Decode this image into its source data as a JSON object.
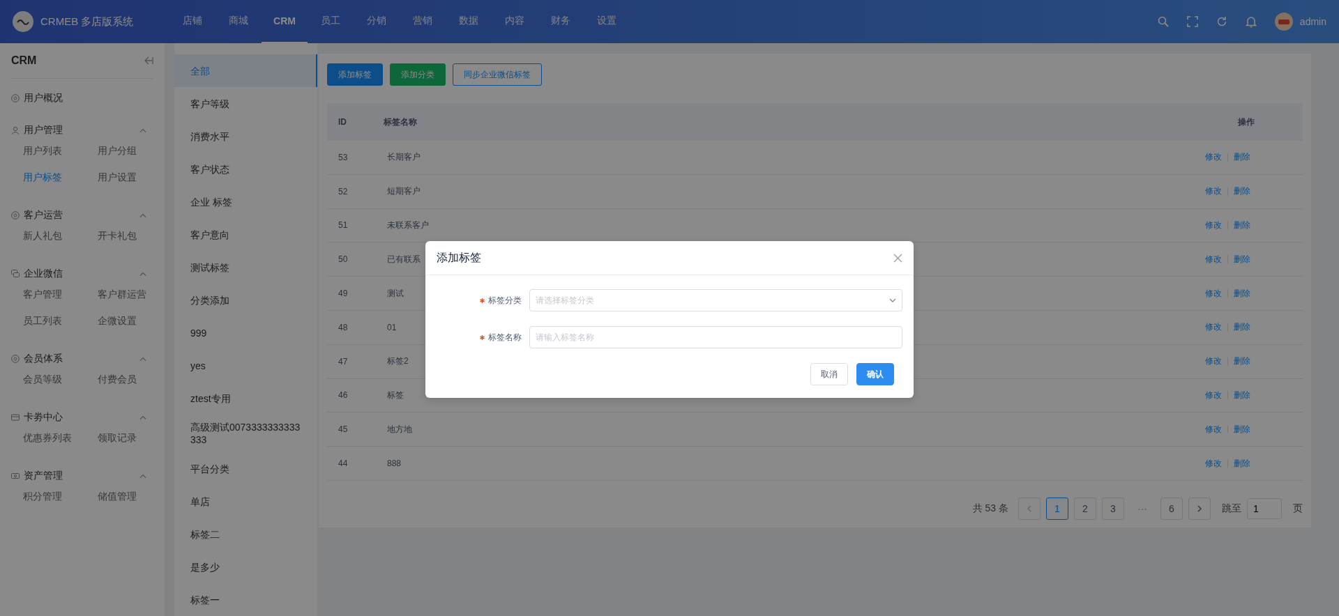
{
  "header": {
    "logo_text": "CRMEB 多店版系统",
    "nav": [
      {
        "label": "店铺",
        "selected": false
      },
      {
        "label": "商城",
        "selected": false
      },
      {
        "label": "CRM",
        "selected": true
      },
      {
        "label": "员工",
        "selected": false
      },
      {
        "label": "分销",
        "selected": false
      },
      {
        "label": "营销",
        "selected": false
      },
      {
        "label": "数据",
        "selected": false
      },
      {
        "label": "内容",
        "selected": false
      },
      {
        "label": "财务",
        "selected": false
      },
      {
        "label": "设置",
        "selected": false
      }
    ],
    "user": "admin"
  },
  "sidebar": {
    "title": "CRM",
    "groups": [
      {
        "label": "用户概况"
      },
      {
        "label": "用户管理",
        "expanded": true,
        "items": [
          {
            "label": "用户列表",
            "selected": false
          },
          {
            "label": "用户分组",
            "selected": false
          },
          {
            "label": "用户标签",
            "selected": true
          },
          {
            "label": "用户设置",
            "selected": false
          }
        ]
      },
      {
        "label": "客户运营",
        "expanded": true,
        "items": [
          {
            "label": "新人礼包",
            "selected": false
          },
          {
            "label": "开卡礼包",
            "selected": false
          }
        ]
      },
      {
        "label": "企业微信",
        "expanded": true,
        "items": [
          {
            "label": "客户管理",
            "selected": false
          },
          {
            "label": "客户群运营",
            "selected": false
          },
          {
            "label": "员工列表",
            "selected": false
          },
          {
            "label": "企微设置",
            "selected": false
          }
        ]
      },
      {
        "label": "会员体系",
        "expanded": true,
        "items": [
          {
            "label": "会员等级",
            "selected": false
          },
          {
            "label": "付费会员",
            "selected": false
          }
        ]
      },
      {
        "label": "卡劵中心",
        "expanded": true,
        "items": [
          {
            "label": "优惠券列表",
            "selected": false
          },
          {
            "label": "领取记录",
            "selected": false
          }
        ]
      },
      {
        "label": "资产管理",
        "expanded": true,
        "items": [
          {
            "label": "积分管理",
            "selected": false
          },
          {
            "label": "储值管理",
            "selected": false
          }
        ]
      }
    ]
  },
  "categories": [
    {
      "label": "全部",
      "selected": true
    },
    {
      "label": "客户等级",
      "selected": false
    },
    {
      "label": "消费水平",
      "selected": false
    },
    {
      "label": "客户状态",
      "selected": false
    },
    {
      "label": "企业 标签",
      "selected": false
    },
    {
      "label": "客户意向",
      "selected": false
    },
    {
      "label": "测试标签",
      "selected": false
    },
    {
      "label": "分类添加",
      "selected": false
    },
    {
      "label": "999",
      "selected": false
    },
    {
      "label": "yes",
      "selected": false
    },
    {
      "label": "ztest专用",
      "selected": false
    },
    {
      "label": "高级测试0073333333333333",
      "selected": false
    },
    {
      "label": "平台分类",
      "selected": false
    },
    {
      "label": "单店",
      "selected": false
    },
    {
      "label": "标签二",
      "selected": false
    },
    {
      "label": "是多少",
      "selected": false
    },
    {
      "label": "标签一",
      "selected": false
    }
  ],
  "toolbar": [
    {
      "label": "添加标签",
      "kind": "primary"
    },
    {
      "label": "添加分类",
      "kind": "success"
    },
    {
      "label": "同步企业微信标签",
      "kind": "outline"
    }
  ],
  "table": {
    "columns": [
      "ID",
      "标签名称",
      "操作"
    ],
    "rows": [
      {
        "id": "53",
        "name": "长期客户",
        "actions": [
          "修改",
          "删除"
        ]
      },
      {
        "id": "52",
        "name": "短期客户",
        "actions": [
          "修改",
          "删除"
        ]
      },
      {
        "id": "51",
        "name": "未联系客户",
        "actions": [
          "修改",
          "删除"
        ]
      },
      {
        "id": "50",
        "name": "已有联系",
        "actions": [
          "修改",
          "删除"
        ]
      },
      {
        "id": "49",
        "name": "测试",
        "actions": [
          "修改",
          "删除"
        ]
      },
      {
        "id": "48",
        "name": "01",
        "actions": [
          "修改",
          "删除"
        ]
      },
      {
        "id": "47",
        "name": "标签2",
        "actions": [
          "修改",
          "删除"
        ]
      },
      {
        "id": "46",
        "name": "标签",
        "actions": [
          "修改",
          "删除"
        ]
      },
      {
        "id": "45",
        "name": "地方地",
        "actions": [
          "修改",
          "删除"
        ]
      },
      {
        "id": "44",
        "name": "888",
        "actions": [
          "修改",
          "删除"
        ]
      }
    ]
  },
  "pagination": {
    "total": "共 53 条",
    "pages": [
      {
        "label": "1",
        "kind": "page",
        "selected": true
      },
      {
        "label": "2",
        "kind": "page",
        "selected": false
      },
      {
        "label": "3",
        "kind": "page",
        "selected": false
      },
      {
        "label": "···",
        "kind": "ellipsis"
      },
      {
        "label": "6",
        "kind": "page",
        "selected": false
      }
    ],
    "jump_label": "跳至",
    "jump_value": "1",
    "suffix": "页"
  },
  "dialog": {
    "title": "添加标签",
    "fields": [
      {
        "label": "标签分类",
        "required": true,
        "kind": "select",
        "placeholder": "请选择标签分类"
      },
      {
        "label": "标签名称",
        "required": true,
        "kind": "input",
        "placeholder": "请输入标签名称"
      }
    ],
    "buttons": [
      {
        "label": "取消",
        "kind": "default"
      },
      {
        "label": "确认",
        "kind": "primary"
      }
    ]
  }
}
